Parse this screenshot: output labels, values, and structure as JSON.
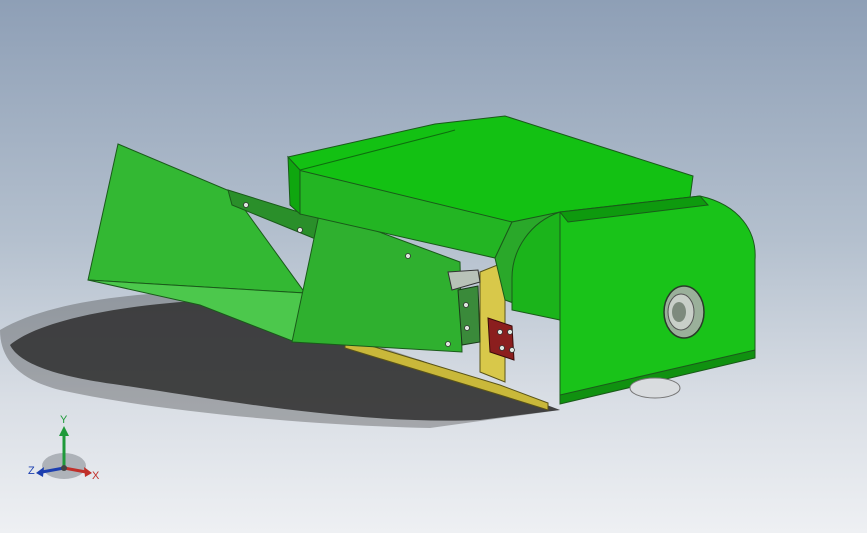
{
  "viewport": {
    "background_top": "#8e9fb6",
    "background_bottom": "#eef0f3"
  },
  "model": {
    "body_color": "#1fc21f",
    "hopper_color": "#2ea82e",
    "base_color": "#c9b83a",
    "bracket_color": "#8b1e1e"
  },
  "triad": {
    "x_label": "X",
    "y_label": "Y",
    "z_label": "Z",
    "x_color": "#c0302a",
    "y_color": "#1f9a3a",
    "z_color": "#1c3fb0"
  }
}
